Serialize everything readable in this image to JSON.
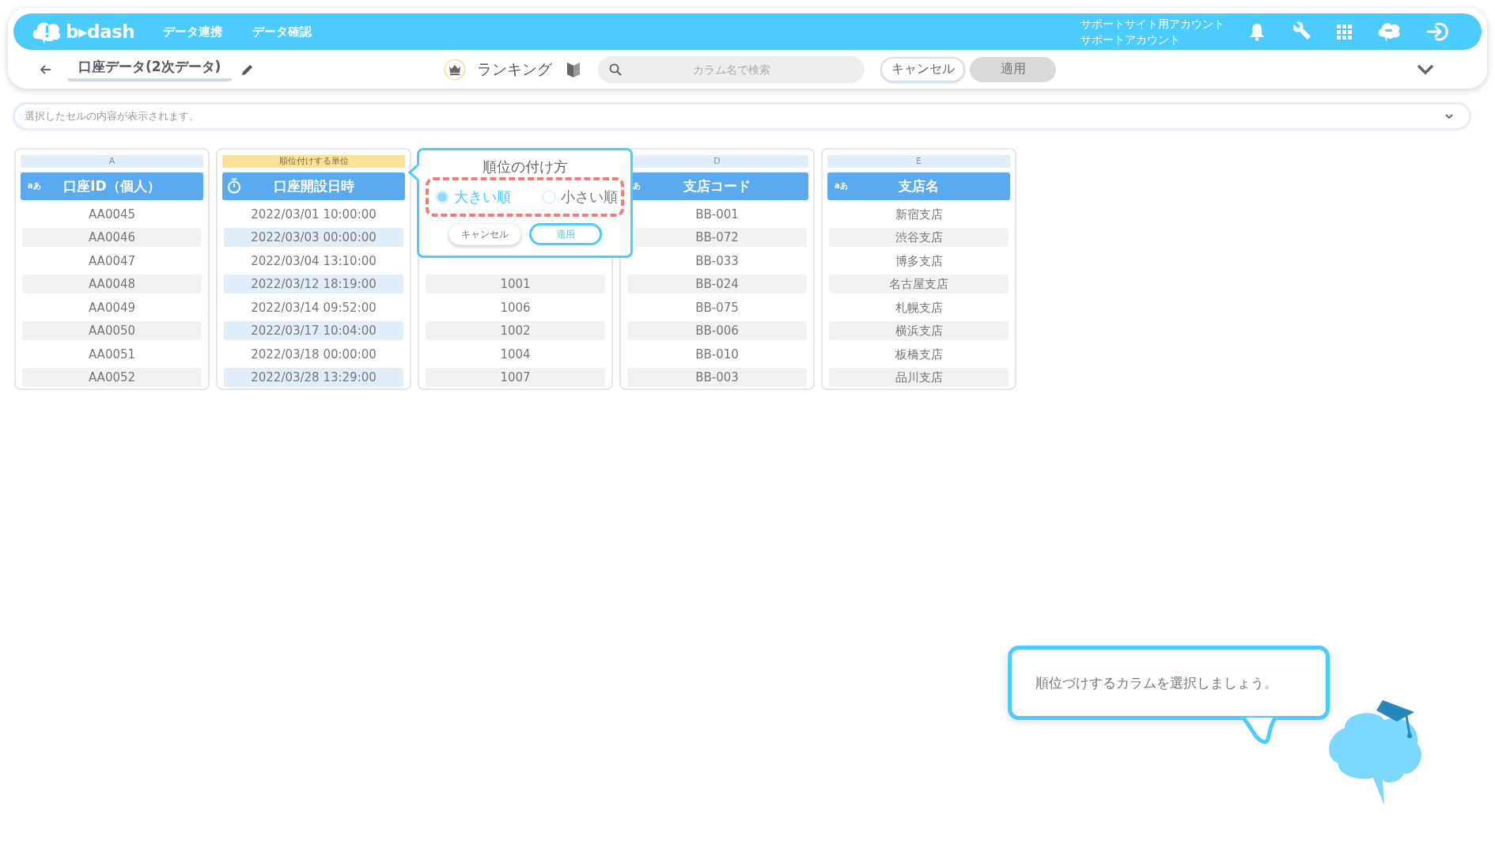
{
  "header": {
    "logo": "b▸dash",
    "nav": [
      {
        "label": "データ連携"
      },
      {
        "label": "データ確認"
      }
    ],
    "account": {
      "site": "サポートサイト用アカウント",
      "user": "サポートアカウント"
    }
  },
  "toolbar": {
    "title": "口座データ(2次データ)",
    "mode": "ランキング",
    "search": {
      "placeholder": "カラム名で検索"
    },
    "buttons": [
      {
        "label": "キャンセル",
        "kind": "cancel",
        "disabled": false
      },
      {
        "label": "適用",
        "kind": "apply",
        "disabled": true
      }
    ]
  },
  "cell_viewer": {
    "placeholder": "選択したセルの内容が表示されます。"
  },
  "columns": [
    {
      "label": "A",
      "selected": false,
      "type_label": "aあ",
      "title": "口座ID（個人）",
      "rows": [
        "AA0045",
        "AA0046",
        "AA0047",
        "AA0048",
        "AA0049",
        "AA0050",
        "AA0051",
        "AA0052"
      ]
    },
    {
      "label": "順位付けする単位",
      "selected": true,
      "kind": "datetime",
      "title": "口座開設日時",
      "rows": [
        "2022/03/01 10:00:00",
        "2022/03/03 00:00:00",
        "2022/03/04 13:10:00",
        "2022/03/12 18:19:00",
        "2022/03/14 09:52:00",
        "2022/03/17 10:04:00",
        "2022/03/18 00:00:00",
        "2022/03/28 13:29:00"
      ]
    },
    {
      "selected": false,
      "rows": [
        "1001",
        "1006",
        "1002",
        "1004",
        "1007"
      ]
    },
    {
      "label": "D",
      "selected": false,
      "type_label": "あ",
      "title": "支店コード",
      "rows": [
        "BB-001",
        "BB-072",
        "BB-033",
        "BB-024",
        "BB-075",
        "BB-006",
        "BB-010",
        "BB-003"
      ]
    },
    {
      "label": "E",
      "selected": false,
      "type_label": "aあ",
      "title": "支店名",
      "rows": [
        "新宿支店",
        "渋谷支店",
        "博多支店",
        "名古屋支店",
        "札幌支店",
        "横浜支店",
        "板橋支店",
        "品川支店"
      ]
    }
  ],
  "popup": {
    "title": "順位の付け方",
    "options": [
      {
        "label": "大きい順",
        "selected": true
      },
      {
        "label": "小さい順",
        "selected": false
      }
    ],
    "buttons": [
      {
        "label": "キャンセル",
        "kind": "cancel"
      },
      {
        "label": "適用",
        "kind": "apply"
      }
    ]
  },
  "guide": {
    "message": "順位づけするカラムを選択しましょう。"
  }
}
